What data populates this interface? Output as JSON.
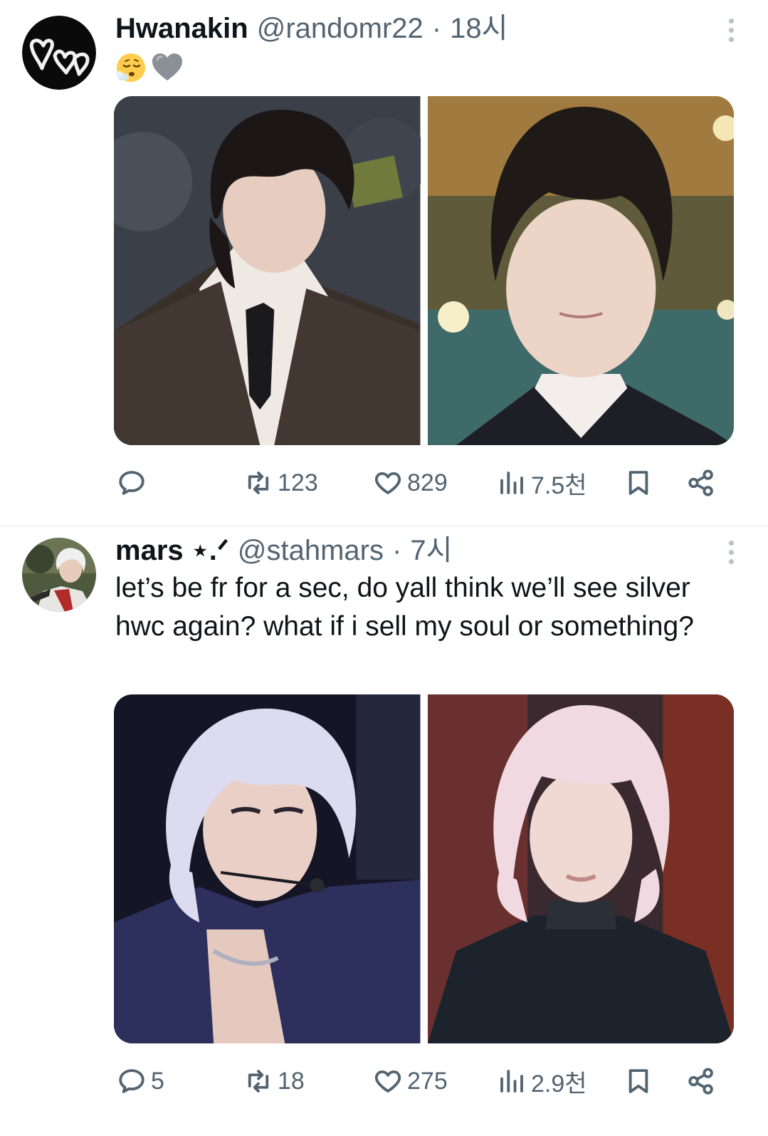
{
  "tweets": [
    {
      "author": {
        "name": "Hwanakin",
        "handle": "@randomr22",
        "separator": "·",
        "time": "18시"
      },
      "emojis": [
        "face-exhaling-emoji",
        "grey-heart-emoji"
      ],
      "text": "",
      "images": [
        "photo-dark-hair-coat-tie",
        "photo-dark-hair-uniform"
      ],
      "stats": {
        "replies": "",
        "retweets": "123",
        "likes": "829",
        "views": "7.5천"
      }
    },
    {
      "author": {
        "name": "mars ⋆.ᐟ",
        "handle": "@stahmars",
        "separator": "·",
        "time": "7시"
      },
      "text": "let’s be fr for a sec, do yall think we’ll see silver hwc again? what if i sell my soul or something?",
      "images": [
        "photo-silver-hair-stage-headset",
        "photo-silver-hair-leather-jacket"
      ],
      "stats": {
        "replies": "5",
        "retweets": "18",
        "likes": "275",
        "views": "2.9천"
      }
    }
  ],
  "colors": {
    "text": "#0f1419",
    "secondary": "#536471",
    "divider": "#e6e9ec",
    "background": "#ffffff"
  }
}
